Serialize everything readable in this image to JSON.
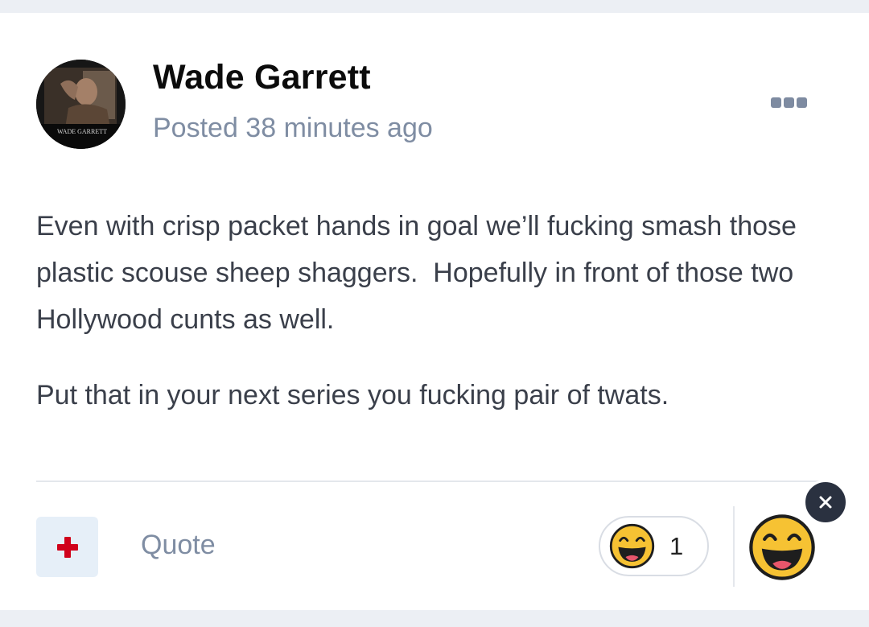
{
  "post": {
    "author": "Wade Garrett",
    "posted": "Posted 38 minutes ago",
    "avatar_caption": "WADE GARRETT",
    "paragraphs": [
      "Even with crisp packet hands in goal we’ll fucking smash those plastic scouse sheep shaggers.  Hopefully in front of those two Hollywood cunts as well.",
      "Put that in your next series you fucking pair of twats."
    ]
  },
  "footer": {
    "quote_label": "Quote",
    "reaction_count": "1",
    "reaction_icon": "grinning-face-icon",
    "add_reaction_icon": "plus-icon",
    "close_icon": "close-icon"
  },
  "colors": {
    "accent_plus": "#d0021b",
    "muted_text": "#7f8da3",
    "emoji_yellow": "#f6c233",
    "close_bg": "#2a3140"
  }
}
